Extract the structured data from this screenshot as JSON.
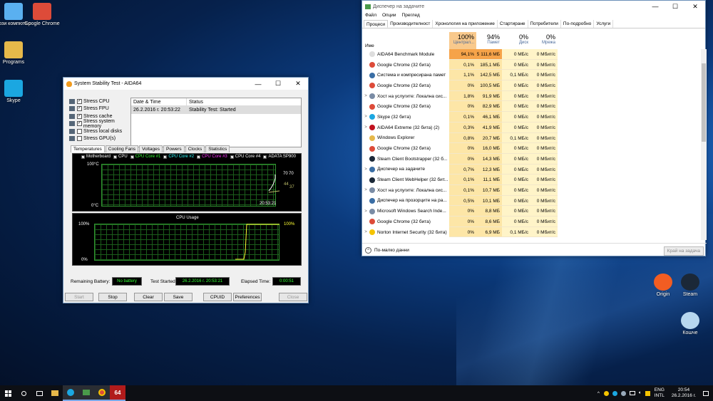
{
  "desktop": {
    "icons": [
      {
        "label": "Този компютър",
        "icon": "computer-icon",
        "color": "#5ab0f0"
      },
      {
        "label": "Google Chrome",
        "icon": "chrome-icon",
        "color": "#dd4b39"
      },
      {
        "label": "Programs",
        "icon": "folder-icon",
        "color": "#e6b84a"
      },
      {
        "label": "Skype",
        "icon": "skype-icon",
        "color": "#1ba7e1"
      }
    ],
    "right_icons": [
      {
        "label": "Origin",
        "icon": "origin-icon",
        "color": "#f25d22"
      },
      {
        "label": "Steam",
        "icon": "steam-icon",
        "color": "#1b2838"
      },
      {
        "label": "Кошче",
        "icon": "recycle-bin-icon",
        "color": "#b7d7ef"
      }
    ]
  },
  "aida": {
    "title": "System Stability Test - AIDA64",
    "stress": [
      "Stress CPU",
      "Stress FPU",
      "Stress cache",
      "Stress system memory",
      "Stress local disks",
      "Stress GPU(s)"
    ],
    "stress_checked": [
      true,
      true,
      true,
      true,
      false,
      false
    ],
    "table": {
      "col1": "Date & Time",
      "col2": "Status",
      "row_date": "26.2.2016 г. 20:53:22",
      "row_status": "Stability Test: Started"
    },
    "tabs": [
      "Temperatures",
      "Cooling Fans",
      "Voltages",
      "Powers",
      "Clocks",
      "Statistics"
    ],
    "temp_legend": [
      "Motherboard",
      "CPU",
      "CPU Core #1",
      "CPU Core #2",
      "CPU Core #3",
      "CPU Core #4",
      "ADATA SP900"
    ],
    "temp_top": "100°C",
    "temp_bottom": "0°C",
    "temp_time": "20:53:21",
    "temp_vals": [
      "70",
      "70",
      "44",
      "37"
    ],
    "cpu_title": "CPU Usage",
    "cpu_top": "100%",
    "cpu_bottom": "0%",
    "cpu_right": "100%",
    "battery_label": "Remaining Battery:",
    "battery_value": "No battery",
    "started_label": "Test Started:",
    "started_value": "26.2.2016 г. 20:53:21",
    "elapsed_label": "Elapsed Time:",
    "elapsed_value": "0:00:51",
    "buttons": [
      "Start",
      "Stop",
      "Clear",
      "Save",
      "CPUID",
      "Preferences",
      "Close"
    ]
  },
  "tm": {
    "title": "Диспечер на задачите",
    "menu": [
      "Файл",
      "Опции",
      "Преглед"
    ],
    "tabs": [
      "Процеси",
      "Производителност",
      "Хронология на приложение",
      "Стартиране",
      "Потребители",
      "По-подробно",
      "Услуги"
    ],
    "col_name": "Име",
    "cpu_pct": "100%",
    "cpu_label": "Централ...",
    "mem_pct": "94%",
    "mem_label": "Памет",
    "disk_pct": "0%",
    "disk_label": "Диск",
    "net_pct": "0%",
    "net_label": "Мрежа",
    "rows": [
      {
        "n": "AIDA64 Benchmark Module",
        "c": "94,1%",
        "m": "5 111,6 МБ",
        "d": "0 МБ/с",
        "w": "0 Мбит/с",
        "e": ""
      },
      {
        "n": "Google Chrome (32 бита)",
        "c": "0,1%",
        "m": "185,1 МБ",
        "d": "0 МБ/с",
        "w": "0 Мбит/с",
        "e": ""
      },
      {
        "n": "Система и компресирана памет",
        "c": "1,1%",
        "m": "142,5 МБ",
        "d": "0,1 МБ/с",
        "w": "0 Мбит/с",
        "e": ""
      },
      {
        "n": "Google Chrome (32 бита)",
        "c": "0%",
        "m": "100,5 МБ",
        "d": "0 МБ/с",
        "w": "0 Мбит/с",
        "e": ""
      },
      {
        "n": "Хост на услугите: Локална сис...",
        "c": "1,8%",
        "m": "91,9 МБ",
        "d": "0 МБ/с",
        "w": "0 Мбит/с",
        "e": ">"
      },
      {
        "n": "Google Chrome (32 бита)",
        "c": "0%",
        "m": "82,9 МБ",
        "d": "0 МБ/с",
        "w": "0 Мбит/с",
        "e": ""
      },
      {
        "n": "Skype (32 бита)",
        "c": "0,1%",
        "m": "46,1 МБ",
        "d": "0 МБ/с",
        "w": "0 Мбит/с",
        "e": ">"
      },
      {
        "n": "AIDA64 Extreme (32 бита) (2)",
        "c": "0,3%",
        "m": "41,9 МБ",
        "d": "0 МБ/с",
        "w": "0 Мбит/с",
        "e": ">"
      },
      {
        "n": "Windows Explorer",
        "c": "0,8%",
        "m": "20,7 МБ",
        "d": "0,1 МБ/с",
        "w": "0 Мбит/с",
        "e": ""
      },
      {
        "n": "Google Chrome (32 бита)",
        "c": "0%",
        "m": "16,0 МБ",
        "d": "0 МБ/с",
        "w": "0 Мбит/с",
        "e": ""
      },
      {
        "n": "Steam Client Bootstrapper (32 б...",
        "c": "0%",
        "m": "14,3 МБ",
        "d": "0 МБ/с",
        "w": "0 Мбит/с",
        "e": ""
      },
      {
        "n": "Диспечер на задачите",
        "c": "0,7%",
        "m": "12,3 МБ",
        "d": "0 МБ/с",
        "w": "0 Мбит/с",
        "e": ">"
      },
      {
        "n": "Steam Client WebHelper (32 бит...",
        "c": "0,1%",
        "m": "11,1 МБ",
        "d": "0 МБ/с",
        "w": "0 Мбит/с",
        "e": ""
      },
      {
        "n": "Хост на услугите: Локална сис...",
        "c": "0,1%",
        "m": "10,7 МБ",
        "d": "0 МБ/с",
        "w": "0 Мбит/с",
        "e": ">"
      },
      {
        "n": "Диспечер на прозорците на ра...",
        "c": "0,5%",
        "m": "10,1 МБ",
        "d": "0 МБ/с",
        "w": "0 Мбит/с",
        "e": ""
      },
      {
        "n": "Microsoft Windows Search Inde...",
        "c": "0%",
        "m": "8,8 МБ",
        "d": "0 МБ/с",
        "w": "0 Мбит/с",
        "e": ">"
      },
      {
        "n": "Google Chrome (32 бита)",
        "c": "0%",
        "m": "8,6 МБ",
        "d": "0 МБ/с",
        "w": "0 Мбит/с",
        "e": ""
      },
      {
        "n": "Norton Internet Security (32 бита)",
        "c": "0%",
        "m": "6,9 МБ",
        "d": "0,1 МБ/с",
        "w": "0 Мбит/с",
        "e": ">"
      }
    ],
    "row_icon_colors": [
      "#ddd",
      "#dd4b39",
      "#3a6ea5",
      "#dd4b39",
      "#7a8ca5",
      "#dd4b39",
      "#1ba7e1",
      "#c1121f",
      "#e6b84a",
      "#dd4b39",
      "#1b2838",
      "#3a6ea5",
      "#1b2838",
      "#7a8ca5",
      "#3a6ea5",
      "#7a8ca5",
      "#dd4b39",
      "#f5c400"
    ],
    "less_details": "По-малко данни",
    "end_task": "Край на задача"
  },
  "taskbar": {
    "lang": "ENG",
    "layout": "INTL",
    "time": "20:54",
    "date": "26.2.2016 г."
  }
}
